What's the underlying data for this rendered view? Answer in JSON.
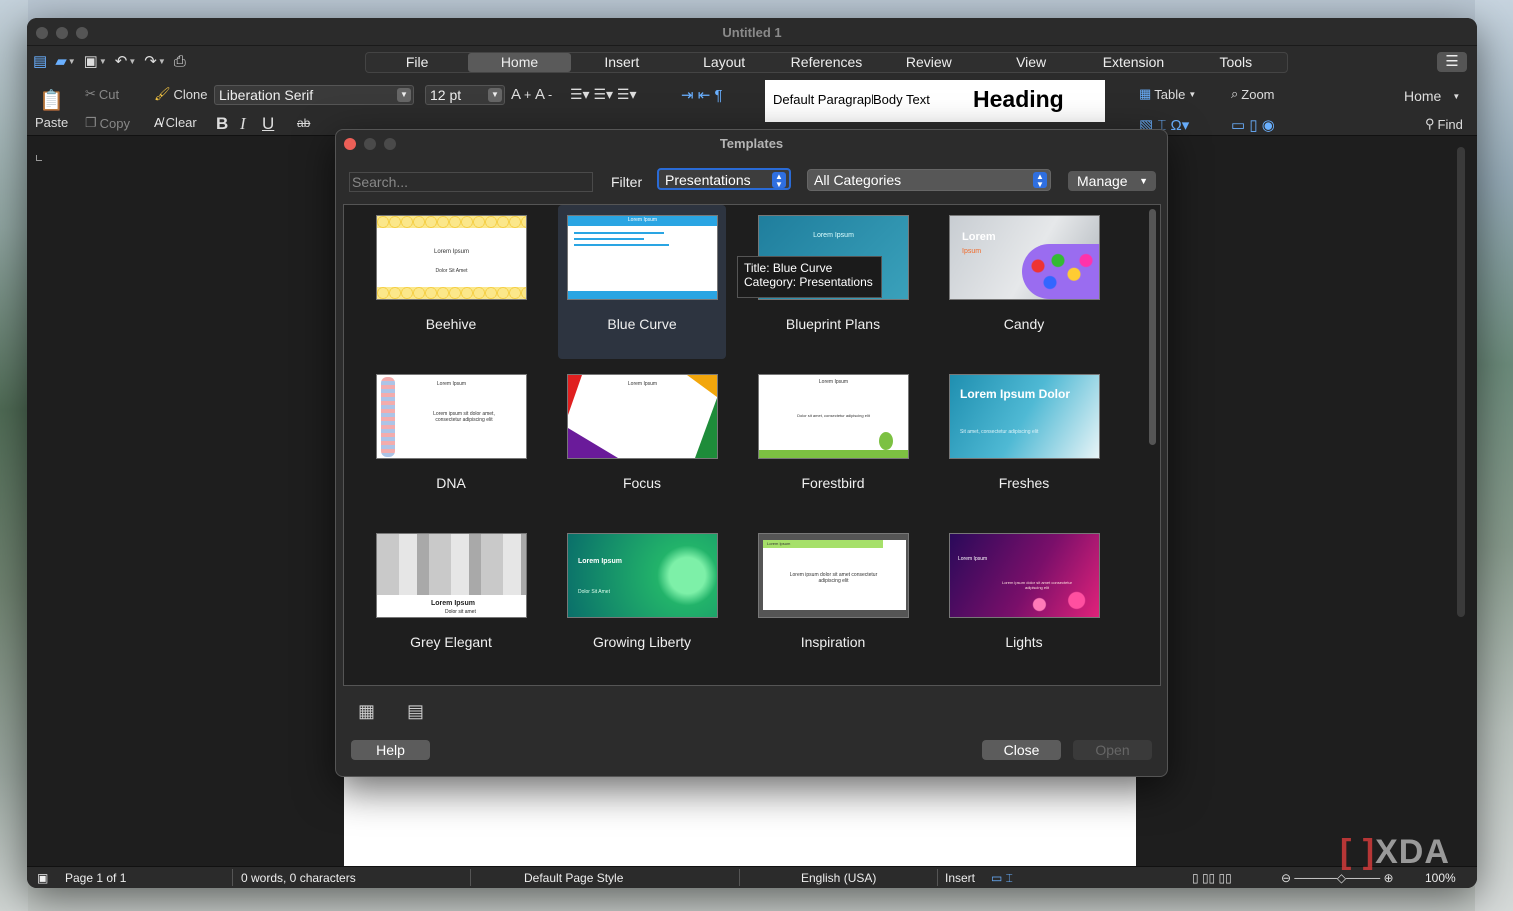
{
  "window": {
    "title": "Untitled 1"
  },
  "tabs": [
    "File",
    "Home",
    "Insert",
    "Layout",
    "References",
    "Review",
    "View",
    "Extension",
    "Tools"
  ],
  "active_tab": "Home",
  "ribbon": {
    "paste": "Paste",
    "cut": "Cut",
    "copy": "Copy",
    "clone": "Clone",
    "clear": "Clear",
    "font_name": "Liberation Serif",
    "font_size": "12 pt",
    "style_default": "Default Paragraph Style",
    "style_body": "Body Text",
    "style_heading": "Heading",
    "table": "Table",
    "zoom": "Zoom",
    "home": "Home",
    "find": "Find"
  },
  "dialog": {
    "title": "Templates",
    "search_placeholder": "Search...",
    "filter_label": "Filter",
    "filter_value": "Presentations",
    "category_value": "All Categories",
    "manage": "Manage",
    "help": "Help",
    "close": "Close",
    "open": "Open",
    "tooltip_line1": "Title: Blue Curve",
    "tooltip_line2": "Category: Presentations",
    "templates": [
      {
        "name": "Beehive"
      },
      {
        "name": "Blue Curve"
      },
      {
        "name": "Blueprint Plans"
      },
      {
        "name": "Candy"
      },
      {
        "name": "DNA"
      },
      {
        "name": "Focus"
      },
      {
        "name": "Forestbird"
      },
      {
        "name": "Freshes"
      },
      {
        "name": "Grey Elegant"
      },
      {
        "name": "Growing Liberty"
      },
      {
        "name": "Inspiration"
      },
      {
        "name": "Lights"
      }
    ],
    "thumb_text": {
      "lorem": "Lorem Ipsum",
      "dolor_sit": "Dolor Sit Amet",
      "lorem_word": "Lorem",
      "ipsum_word": "Ipsum",
      "lorem_dolor": "Lorem Ipsum Dolor",
      "dolor_sit_lower": "Dolor sit amet",
      "sit_amet": "Sit amet, consectetur adipiscing elit",
      "lorem_sentence": "Lorem ipsum sit dolor amet, consectetur adipiscing elit",
      "dolor_sentence": "Dolor sit amet, consectetur adipiscing elit",
      "lorem_dolor_sentence": "Lorem ipsum dolor sit amet consectetur adipiscing elit"
    }
  },
  "status": {
    "page": "Page 1 of 1",
    "words": "0 words, 0 characters",
    "page_style": "Default Page Style",
    "language": "English (USA)",
    "mode": "Insert",
    "zoom": "100%"
  },
  "watermark": "XDA"
}
